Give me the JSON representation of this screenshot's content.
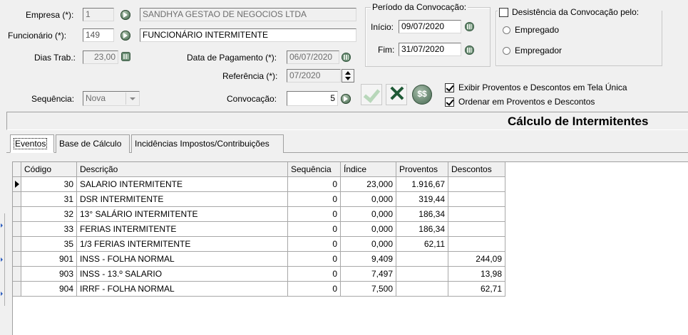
{
  "form": {
    "empresa_label": "Empresa (*):",
    "empresa_code": "1",
    "empresa_name": "SANDHYA GESTAO DE NEGOCIOS LTDA",
    "funcionario_label": "Funcionário (*):",
    "funcionario_code": "149",
    "funcionario_name": "FUNCIONÁRIO INTERMITENTE",
    "dias_label": "Dias Trab.:",
    "dias_value": "23,00",
    "data_pag_label": "Data de Pagamento (*):",
    "data_pag_value": "06/07/2020",
    "referencia_label": "Referência (*):",
    "referencia_value": "07/2020",
    "sequencia_label": "Sequência:",
    "sequencia_value": "Nova",
    "convocacao_label": "Convocação:",
    "convocacao_value": "5"
  },
  "periodo": {
    "title": "Período da Convocação:",
    "inicio_label": "Início:",
    "inicio_value": "09/07/2020",
    "fim_label": "Fim:",
    "fim_value": "31/07/2020"
  },
  "desistencia": {
    "title": "Desistência da Convocação pelo:",
    "checked": false,
    "options": [
      "Empregado",
      "Empregador"
    ]
  },
  "options": {
    "exibir_label": "Exibir Proventos e Descontos em Tela Única",
    "exibir_checked": true,
    "ordenar_label": "Ordenar em Proventos e Descontos",
    "ordenar_checked": true
  },
  "header_title": "Cálculo de Intermitentes",
  "tabs": [
    "Eventos",
    "Base de Cálculo",
    "Incidências Impostos/Contribuições"
  ],
  "grid": {
    "columns": [
      "Código",
      "Descrição",
      "Sequência",
      "Índice",
      "Proventos",
      "Descontos"
    ],
    "rows": [
      {
        "codigo": "30",
        "descricao": "SALARIO INTERMITENTE",
        "sequencia": "0",
        "indice": "23,000",
        "proventos": "1.916,67",
        "descontos": ""
      },
      {
        "codigo": "31",
        "descricao": "DSR INTERMITENTE",
        "sequencia": "0",
        "indice": "0,000",
        "proventos": "319,44",
        "descontos": ""
      },
      {
        "codigo": "32",
        "descricao": "13° SALÁRIO INTERMITENTE",
        "sequencia": "0",
        "indice": "0,000",
        "proventos": "186,34",
        "descontos": ""
      },
      {
        "codigo": "33",
        "descricao": "FERIAS INTERMITENTE",
        "sequencia": "0",
        "indice": "0,000",
        "proventos": "186,34",
        "descontos": ""
      },
      {
        "codigo": "35",
        "descricao": "1/3 FERIAS INTERMITENTE",
        "sequencia": "0",
        "indice": "0,000",
        "proventos": "62,11",
        "descontos": ""
      },
      {
        "codigo": "901",
        "descricao": "INSS - FOLHA NORMAL",
        "sequencia": "0",
        "indice": "9,409",
        "proventos": "",
        "descontos": "244,09"
      },
      {
        "codigo": "903",
        "descricao": "INSS - 13.º SALARIO",
        "sequencia": "0",
        "indice": "7,497",
        "proventos": "",
        "descontos": "13,98"
      },
      {
        "codigo": "904",
        "descricao": "IRRF - FOLHA NORMAL",
        "sequencia": "0",
        "indice": "7,500",
        "proventos": "",
        "descontos": "62,71"
      }
    ]
  },
  "colors": {
    "ok_button": "#b8d7ba",
    "cancel_button": "#1f5a36",
    "money_button": "#5f7f68"
  },
  "icons": [
    "lookup-arrow-icon",
    "calculator-icon",
    "calendar-icon",
    "confirm-check-icon",
    "cancel-x-icon",
    "money-icon",
    "row-pointer-icon"
  ]
}
